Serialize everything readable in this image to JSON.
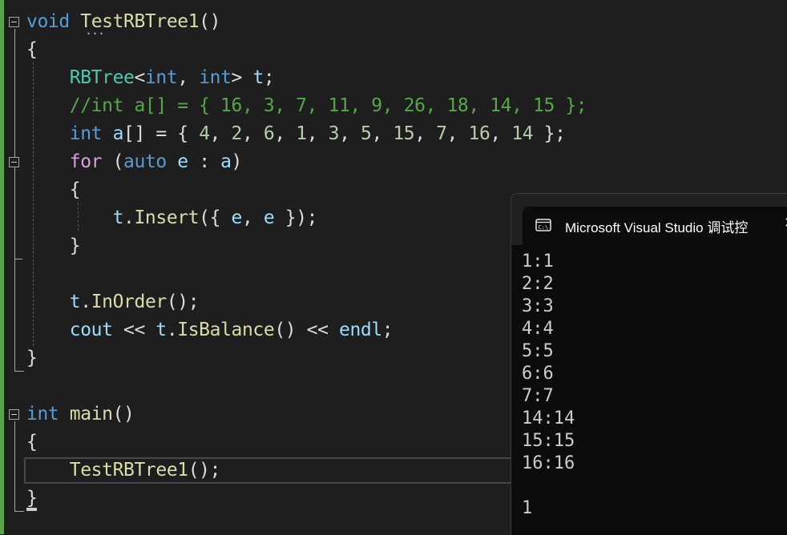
{
  "editor": {
    "lines": [
      [
        {
          "t": "void",
          "c": "kw"
        },
        {
          "t": " "
        },
        {
          "t": "TestRBTree1",
          "c": "fn"
        },
        {
          "t": "()"
        }
      ],
      [
        {
          "t": "{"
        }
      ],
      [],
      [
        {
          "t": "    RBTree",
          "c": "type"
        },
        {
          "t": "<"
        },
        {
          "t": "int",
          "c": "kw"
        },
        {
          "t": ", "
        },
        {
          "t": "int",
          "c": "kw"
        },
        {
          "t": "> "
        },
        {
          "t": "t",
          "c": "var"
        },
        {
          "t": ";"
        }
      ],
      [
        {
          "t": "    //int a[] = { 16, 3, 7, 11, 9, 26, 18, 14, 15 };",
          "c": "cmt"
        }
      ],
      [
        {
          "t": "    int",
          "c": "kw"
        },
        {
          "t": " "
        },
        {
          "t": "a",
          "c": "var"
        },
        {
          "t": "[] = { "
        },
        {
          "t": "4",
          "c": "num"
        },
        {
          "t": ", "
        },
        {
          "t": "2",
          "c": "num"
        },
        {
          "t": ", "
        },
        {
          "t": "6",
          "c": "num"
        },
        {
          "t": ", "
        },
        {
          "t": "1",
          "c": "num"
        },
        {
          "t": ", "
        },
        {
          "t": "3",
          "c": "num"
        },
        {
          "t": ", "
        },
        {
          "t": "5",
          "c": "num"
        },
        {
          "t": ", "
        },
        {
          "t": "15",
          "c": "num"
        },
        {
          "t": ", "
        },
        {
          "t": "7",
          "c": "num"
        },
        {
          "t": ", "
        },
        {
          "t": "16",
          "c": "num"
        },
        {
          "t": ", "
        },
        {
          "t": "14",
          "c": "num"
        },
        {
          "t": " };"
        }
      ],
      [
        {
          "t": "    for",
          "c": "ctl"
        },
        {
          "t": " ("
        },
        {
          "t": "auto",
          "c": "kw"
        },
        {
          "t": " "
        },
        {
          "t": "e",
          "c": "var"
        },
        {
          "t": " : "
        },
        {
          "t": "a",
          "c": "var"
        },
        {
          "t": ")"
        }
      ],
      [
        {
          "t": "    {"
        }
      ],
      [
        {
          "t": "        t",
          "c": "var"
        },
        {
          "t": "."
        },
        {
          "t": "Insert",
          "c": "fn"
        },
        {
          "t": "({ "
        },
        {
          "t": "e",
          "c": "var"
        },
        {
          "t": ", "
        },
        {
          "t": "e",
          "c": "var"
        },
        {
          "t": " });"
        }
      ],
      [
        {
          "t": "    }"
        }
      ],
      [],
      [
        {
          "t": "    t",
          "c": "var"
        },
        {
          "t": "."
        },
        {
          "t": "InOrder",
          "c": "fn"
        },
        {
          "t": "();"
        }
      ],
      [
        {
          "t": "    cout",
          "c": "var"
        },
        {
          "t": " << "
        },
        {
          "t": "t",
          "c": "var"
        },
        {
          "t": "."
        },
        {
          "t": "IsBalance",
          "c": "fn"
        },
        {
          "t": "() << "
        },
        {
          "t": "endl",
          "c": "var"
        },
        {
          "t": ";"
        }
      ],
      [
        {
          "t": "}"
        }
      ],
      [],
      [
        {
          "t": "int",
          "c": "kw"
        },
        {
          "t": " "
        },
        {
          "t": "main",
          "c": "fn"
        },
        {
          "t": "()"
        }
      ],
      [
        {
          "t": "{"
        }
      ],
      [
        {
          "t": "    TestRBTree1",
          "c": "fn"
        },
        {
          "t": "();"
        }
      ],
      [
        {
          "t": "}"
        }
      ]
    ],
    "squiggle": "···"
  },
  "console": {
    "title": "Microsoft Visual Studio 调试控",
    "close_glyph": "✕",
    "icon": "console-app-icon",
    "output": [
      "1:1",
      "2:2",
      "3:3",
      "4:4",
      "5:5",
      "6:6",
      "7:7",
      "14:14",
      "15:15",
      "16:16",
      "",
      "1"
    ]
  },
  "colors": {
    "keyword": "#569cd6",
    "control": "#d8a0df",
    "type": "#4ec9b0",
    "function": "#dcdcaa",
    "variable": "#9cdcfe",
    "number": "#b5cea8",
    "comment": "#57a64a",
    "text": "#dcdcdc",
    "background": "#1e1e1e",
    "console_background": "#0c0c0c"
  }
}
